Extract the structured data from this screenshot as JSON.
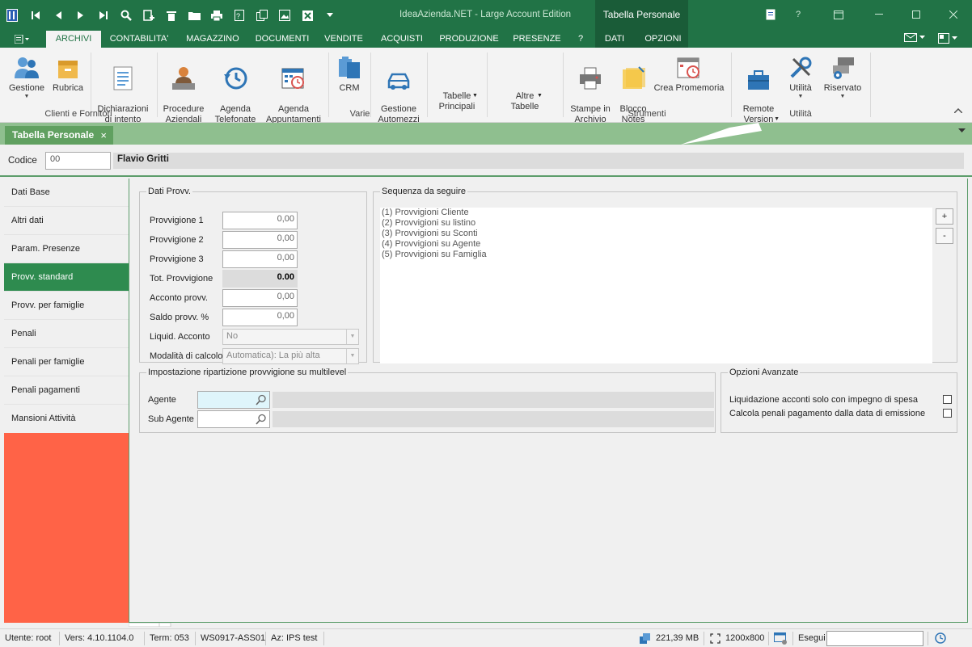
{
  "app": {
    "title": "IdeaAzienda.NET - Large Account Edition",
    "context_tab_title": "Tabella Personale",
    "accent": "#217346"
  },
  "qat_icons": [
    "app-logo-icon",
    "first-record-icon",
    "previous-record-icon",
    "next-record-icon",
    "last-record-icon",
    "search-icon",
    "new-document-icon",
    "delete-icon",
    "open-folder-icon",
    "print-icon",
    "report-icon",
    "copy-icon",
    "image-icon",
    "excel-icon",
    "customize-arrow-icon"
  ],
  "menu_tabs": [
    "ARCHIVI",
    "CONTABILITA'",
    "MAGAZZINO",
    "DOCUMENTI",
    "VENDITE",
    "ACQUISTI",
    "PRODUZIONE",
    "PRESENZE",
    "?",
    "DATI",
    "OPZIONI"
  ],
  "ribbon": {
    "buttons": [
      {
        "label": "Gestione",
        "dropdown": true
      },
      {
        "label": "Rubrica"
      },
      {
        "label": "Dichiarazioni\ndi intento"
      },
      {
        "label": "Procedure\nAziendali"
      },
      {
        "label": "Agenda\nTelefonate"
      },
      {
        "label": "Agenda\nAppuntamenti"
      },
      {
        "label": "CRM"
      },
      {
        "label": "Gestione\nAutomezzi"
      },
      {
        "label": "Tabelle\nPrincipali",
        "dropdown": true
      },
      {
        "label": "Altre\nTabelle",
        "dropdown": true
      },
      {
        "label": "Stampe in\nArchivio"
      },
      {
        "label": "Blocco\nNotes"
      },
      {
        "label": "Crea Promemoria"
      },
      {
        "label": "Remote\nVersion",
        "dropdown": true
      },
      {
        "label": "Utilità",
        "dropdown": true
      },
      {
        "label": "Riservato",
        "dropdown": true
      }
    ],
    "groups": [
      "Clienti e Fornitori",
      "Varie",
      "Strumenti",
      "Utilità"
    ]
  },
  "document_tab": {
    "label": "Tabella Personale"
  },
  "header": {
    "code_label": "Codice",
    "code_value": "00",
    "name": "Flavio Gritti"
  },
  "nav": {
    "items": [
      "Dati Base",
      "Altri dati",
      "Param. Presenze",
      "Provv. standard",
      "Provv. per famiglie",
      "Penali",
      "Penali per famiglie",
      "Penali pagamenti",
      "Mansioni Attività"
    ],
    "active_index": 3
  },
  "dati_provv": {
    "legend": "Dati Provv.",
    "fields": [
      {
        "label": "Provvigione 1",
        "value": "0,00"
      },
      {
        "label": "Provvigione 2",
        "value": "0,00"
      },
      {
        "label": "Provvigione 3",
        "value": "0,00"
      },
      {
        "label": "Tot. Provvigione",
        "value": "0.00"
      },
      {
        "label": "Acconto provv.",
        "value": "0,00"
      },
      {
        "label": "Saldo provv. %",
        "value": "0,00"
      }
    ],
    "liquid_label": "Liquid. Acconto",
    "liquid_value": "No",
    "modalita_label": "Modalità di calcolo",
    "modalita_value": "Automatica): La più alta"
  },
  "sequenza": {
    "legend": "Sequenza da seguire",
    "items": [
      "(1) Provvigioni Cliente",
      "(2) Provvigioni su listino",
      "(3) Provvigioni su Sconti",
      "(4) Provvigioni su Agente",
      "(5) Provvigioni su Famiglia"
    ],
    "plus": "+",
    "minus": "-"
  },
  "multilevel": {
    "legend": "Impostazione ripartizione provvigione su multilevel",
    "agente_label": "Agente",
    "sub_agente_label": "Sub Agente"
  },
  "opzioni": {
    "legend": "Opzioni Avanzate",
    "options": [
      {
        "label": "Liquidazione acconti solo con impegno di spesa",
        "checked": false
      },
      {
        "label": "Calcola penali pagamento dalla data di emissione",
        "checked": false
      }
    ]
  },
  "status": {
    "user": "Utente: root",
    "version": "Vers: 4.10.1104.0",
    "term": "Term: 053",
    "ws": "WS0917-ASS01",
    "az": "Az: IPS test",
    "memory": "221,39 MB",
    "resolution": "1200x800",
    "esegui": "Esegui"
  }
}
